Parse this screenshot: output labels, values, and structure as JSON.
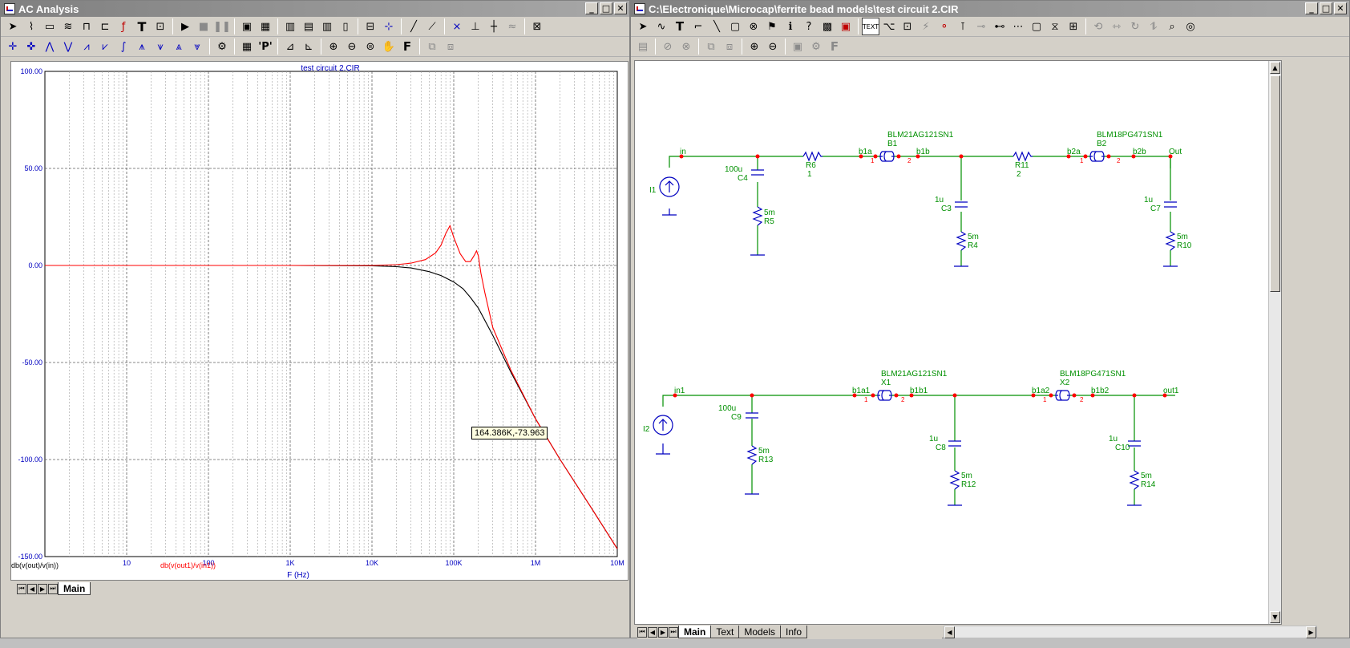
{
  "ac_window": {
    "title": "AC Analysis",
    "min": "_",
    "max": "□",
    "close": "✕"
  },
  "schematic_window": {
    "title": "C:\\Electronique\\Microcap\\ferrite bead models\\test circuit 2.CIR",
    "min": "_",
    "max": "□",
    "close": "✕"
  },
  "plot": {
    "title": "test circuit 2.CIR",
    "cursor_readout": "164.386K,-73.963",
    "tabs": [
      {
        "label": "Main"
      }
    ]
  },
  "chart_data": {
    "type": "line",
    "title": "test circuit 2.CIR",
    "xlabel": "F (Hz)",
    "ylabel": "",
    "x_scale": "log",
    "xlim": [
      1,
      10000000
    ],
    "ylim": [
      -150,
      100
    ],
    "x_ticks": [
      "10",
      "100",
      "1K",
      "10K",
      "100K",
      "1M",
      "10M"
    ],
    "y_ticks": [
      "100.00",
      "50.00",
      "0.00",
      "-50.00",
      "-100.00",
      "-150.00"
    ],
    "y_tick_values": [
      100,
      50,
      0,
      -50,
      -100,
      -150
    ],
    "grid": true,
    "series": [
      {
        "name": "db(v(out)/v(in))",
        "color": "#000000",
        "x": [
          1,
          1000,
          10000,
          20000,
          30000,
          50000,
          70000,
          100000,
          130000,
          160000,
          200000,
          300000,
          500000,
          1000000,
          2000000,
          5000000,
          10000000
        ],
        "y": [
          0,
          0,
          -0.2,
          -0.6,
          -1.3,
          -3.2,
          -5.2,
          -8.5,
          -12,
          -16.5,
          -22,
          -36,
          -55,
          -79,
          -100,
          -126,
          -146
        ]
      },
      {
        "name": "db(v(out1)/v(in1))",
        "color": "#ff0000",
        "x": [
          1,
          1000,
          10000,
          20000,
          30000,
          45000,
          60000,
          70000,
          80000,
          90000,
          100000,
          120000,
          140000,
          160000,
          180000,
          190000,
          200000,
          215000,
          240000,
          300000,
          500000,
          1000000,
          2000000,
          5000000,
          10000000
        ],
        "y": [
          0,
          0,
          0,
          0.4,
          1.2,
          3,
          6.5,
          10.5,
          16.5,
          20.5,
          14.5,
          6,
          2,
          2,
          5.5,
          7.5,
          5,
          -4,
          -14,
          -32,
          -54,
          -79,
          -100,
          -126,
          -146
        ]
      }
    ]
  },
  "schematic": {
    "tabs": [
      {
        "label": "Main"
      },
      {
        "label": "Text"
      },
      {
        "label": "Models"
      },
      {
        "label": "Info"
      }
    ],
    "labels": {
      "bead1": "BLM21AG121SN1",
      "b1": "B1",
      "bead2": "BLM18PG471SN1",
      "b2": "B2",
      "in": "in",
      "b1a": "b1a",
      "b1b": "b1b",
      "b2a": "b2a",
      "b2b": "b2b",
      "out": "Out",
      "c4v": "100u",
      "c4": "C4",
      "r6": "R6",
      "r6v": "1",
      "r11": "R11",
      "r11v": "2",
      "i1": "I1",
      "r5v": "5m",
      "r5": "R5",
      "c3v": "1u",
      "c3": "C3",
      "r4v": "5m",
      "r4": "R4",
      "c7v": "1u",
      "c7": "C7",
      "r10v": "5m",
      "r10": "R10",
      "bead3": "BLM21AG121SN1",
      "x1": "X1",
      "bead4": "BLM18PG471SN1",
      "x2": "X2",
      "in1": "in1",
      "b1a1": "b1a1",
      "b1b1": "b1b1",
      "b1a2": "b1a2",
      "b1b2": "b1b2",
      "out1": "out1",
      "c9v": "100u",
      "c9": "C9",
      "i2": "I2",
      "r13v": "5m",
      "r13": "R13",
      "c8v": "1u",
      "c8": "C8",
      "r12v": "5m",
      "r12": "R12",
      "c10v": "1u",
      "c10": "C10",
      "r14v": "5m",
      "r14": "R14",
      "pin1": "1",
      "pin2": "2"
    }
  },
  "toolbar_icons": {
    "ac_row1": [
      "arrow-icon",
      "wave-icon",
      "scope-icon",
      "scope2-icon",
      "step-icon",
      "graph-icon",
      "fo-icon",
      "text-tool-icon",
      "probe-icon",
      "run-icon",
      "stop-icon",
      "pause-icon",
      "grid1-icon",
      "grid2-icon",
      "grid3-icon",
      "grid4-icon",
      "grid5-icon",
      "grid6-icon",
      "win-icon",
      "cursor-icon",
      "line-icon",
      "line2-icon",
      "tangent-icon",
      "slope-icon",
      "marker-icon",
      "export-icon"
    ],
    "ac_row2": [
      "cursor-l-icon",
      "cursor-r-icon",
      "peak-icon",
      "valley-icon",
      "high-icon",
      "low-icon",
      "inflect-icon",
      "top-icon",
      "bottom-icon",
      "global-icon",
      "gear-icon",
      "table-icon",
      "p-icon",
      "scale-icon",
      "scale2-icon",
      "zoom-in-icon",
      "zoom-out-icon",
      "zoom-fit-icon",
      "pan-icon",
      "font-icon",
      "tile-icon",
      "cascade-icon"
    ]
  }
}
